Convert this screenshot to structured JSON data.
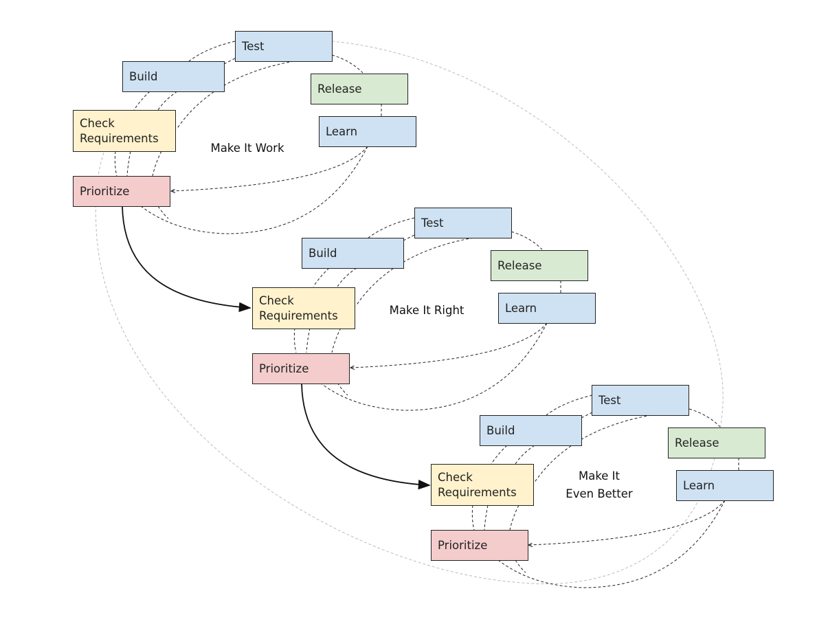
{
  "colors": {
    "build_test_learn": "#cfe2f3",
    "release": "#d9ead3",
    "check_requirements": "#fff2cc",
    "prioritize": "#f4cccc"
  },
  "cycles": [
    {
      "title": "Make It Work",
      "test": "Test",
      "build": "Build",
      "release": "Release",
      "learn": "Learn",
      "check_line1": "Check",
      "check_line2": "Requirements",
      "prioritize": "Prioritize"
    },
    {
      "title": "Make It Right",
      "test": "Test",
      "build": "Build",
      "release": "Release",
      "learn": "Learn",
      "check_line1": "Check",
      "check_line2": "Requirements",
      "prioritize": "Prioritize"
    },
    {
      "title_line1": "Make It",
      "title_line2": "Even Better",
      "test": "Test",
      "build": "Build",
      "release": "Release",
      "learn": "Learn",
      "check_line1": "Check",
      "check_line2": "Requirements",
      "prioritize": "Prioritize"
    }
  ]
}
